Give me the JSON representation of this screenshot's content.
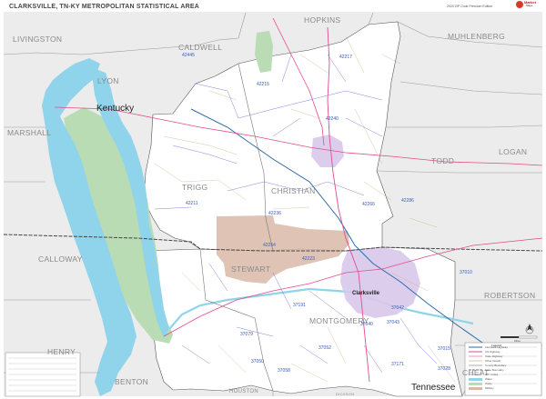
{
  "title": "CLARKSVILLE, TN-KY METROPOLITAN STATISTICAL AREA",
  "subtitle": "2020 ZIP Code Premium Edition",
  "logo": {
    "line1": "Market",
    "line2": "Maps"
  },
  "states": {
    "kentucky": "Kentucky",
    "tennessee": "Tennessee"
  },
  "counties": {
    "livingston": "LIVINGSTON",
    "caldwell": "CALDWELL",
    "hopkins": "HOPKINS",
    "muhlenberg": "MUHLENBERG",
    "lyon": "LYON",
    "marshall": "MARSHALL",
    "trigg": "TRIGG",
    "christian": "CHRISTIAN",
    "todd": "TODD",
    "logan": "LOGAN",
    "calloway": "CALLOWAY",
    "stewart": "STEWART",
    "montgomery": "MONTGOMERY",
    "robertson": "ROBERTSON",
    "henry": "HENRY",
    "benton": "BENTON",
    "houston": "HOUSTON",
    "cheatham": "CHEAT",
    "dickson": "DICKSON"
  },
  "cities": {
    "clarksville": "Clarksville"
  },
  "zips": [
    "42445",
    "42217",
    "42215",
    "42240",
    "42211",
    "42236",
    "42266",
    "42254",
    "42223",
    "42286",
    "37010",
    "37191",
    "37079",
    "37050",
    "37042",
    "37040",
    "37043",
    "37052",
    "37171",
    "37058",
    "37028",
    "37015"
  ],
  "colors": {
    "water": "#8fd4ea",
    "park": "#b9dcb5",
    "military": "#d9b8a8",
    "urban": "#d9c8ea",
    "outside": "#ececec",
    "zip_boundary": "#6d63c9",
    "road_major": "#e24b8f"
  },
  "legend": {
    "title": "Legend",
    "items": [
      "Interstate Highway",
      "US Highway",
      "State Highway",
      "Other Roads",
      "County Boundary",
      "State Boundary",
      "ZIP Codes",
      "Water",
      "Parks",
      "Military"
    ]
  },
  "scale_label": "Miles",
  "icons": [
    "compass-icon",
    "logo-icon"
  ]
}
